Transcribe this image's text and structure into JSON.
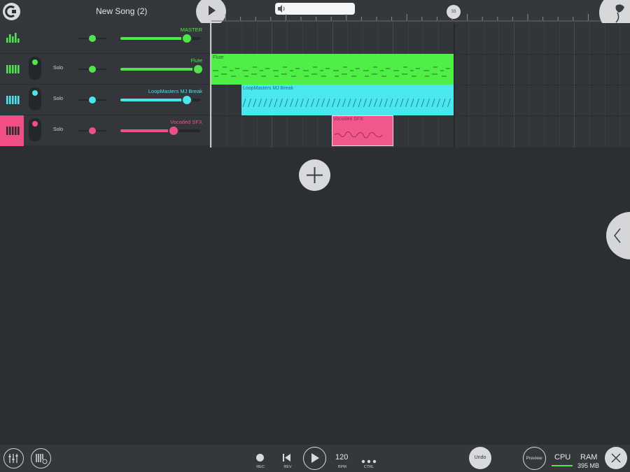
{
  "header": {
    "song_title": "New Song (2)",
    "position_label": "33"
  },
  "tracks": [
    {
      "name": "MASTER",
      "color": "#4ee64a",
      "solo_label": "",
      "pan": 0.5,
      "volume": 0.83
    },
    {
      "name": "Flute",
      "color": "#4ee64a",
      "solo_label": "Solo",
      "pan": 0.5,
      "volume": 0.97
    },
    {
      "name": "LoopMasters MJ Break",
      "color": "#48e6ee",
      "solo_label": "Solo",
      "pan": 0.5,
      "volume": 0.83
    },
    {
      "name": "Vocoded SFX",
      "color": "#f04f86",
      "solo_label": "Solo",
      "pan": 0.5,
      "volume": 0.67
    }
  ],
  "clips": [
    {
      "label": "Flute",
      "color": "#4fef45",
      "text_color": "#2f6b2b"
    },
    {
      "label": "LoopMasters MJ Break",
      "color": "#4ae7ef",
      "text_color": "#1f6f75"
    },
    {
      "label": "Vocoded SFX",
      "color": "#f2578b",
      "text_color": "#8a2447"
    }
  ],
  "transport": {
    "rec_label": "REC",
    "rev_label": "REV",
    "bpm_value": "120",
    "bpm_label": "BPM",
    "ctrl_label": "CTRL",
    "undo_label": "Undo",
    "preview_label": "Preview",
    "cpu_label": "CPU",
    "ram_label": "RAM",
    "ram_value": "395 MB"
  },
  "icons": {
    "logo": "fl-loop-icon",
    "play": "play-icon",
    "volume": "speaker-icon",
    "mixer": "mixer-icon",
    "channel_rack": "channel-rack-icon",
    "record": "record-icon",
    "rewind": "rewind-icon",
    "more": "more-dots-icon",
    "add": "plus-icon",
    "side": "chevron-left-icon",
    "close": "close-icon",
    "fl_fruit": "fl-fruit-logo"
  }
}
